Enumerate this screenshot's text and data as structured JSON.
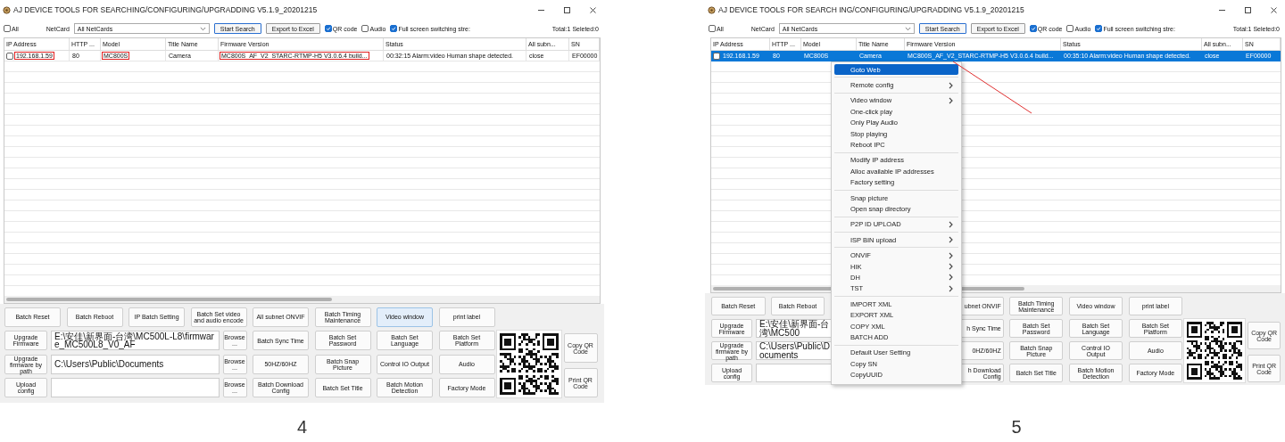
{
  "figures": [
    {
      "window": {
        "title": "AJ DEVICE TOOLS FOR SEARCHING/CONFIGURING/UPGRADDING V5.1.9_20201215"
      },
      "toolbar": {
        "select_all": {
          "label": "All",
          "checked": false
        },
        "netcard_label": "NetCard",
        "netcard": "All NetCards",
        "buttons": [
          {
            "label": "Start Search",
            "focused": true
          },
          {
            "label": "Export to Excel",
            "focused": false
          }
        ],
        "options": [
          {
            "label": "QR code",
            "checked": true
          },
          {
            "label": "Audio",
            "checked": false
          },
          {
            "label": "Full screen switching stre:",
            "checked": true
          }
        ],
        "summary": "Total:1 Seleted:0"
      },
      "table": {
        "columns": [
          "IP Address",
          "HTTP ...",
          "Model",
          "Title Name",
          "Firmware Version",
          "Status",
          "All subn...",
          "SN"
        ],
        "rows": [
          {
            "checked": false,
            "selected": false,
            "cells": [
              {
                "text": "192.168.1.59",
                "outlined": true
              },
              {
                "text": "80",
                "outlined": false
              },
              {
                "text": "MC800S",
                "outlined": true
              },
              {
                "text": "Camera",
                "outlined": false
              },
              {
                "text": "MC800S_AF_V2_STARC-RTMP-H5 V3.0.6.4 build...",
                "outlined": true
              },
              {
                "text": "00:32:15 Alarm:video Human shape detected.",
                "outlined": false
              },
              {
                "text": "close",
                "outlined": false
              },
              {
                "text": "EF00000",
                "outlined": false
              }
            ]
          }
        ]
      },
      "actions": {
        "top_row": [
          {
            "kind": "button",
            "label": "Batch Reset",
            "focused": false
          },
          {
            "kind": "button",
            "label": "Batch Reboot",
            "focused": false
          },
          {
            "kind": "button",
            "label": "IP Batch Setting",
            "focused": false
          },
          {
            "kind": "button",
            "label": "Batch Set video and audio encode",
            "focused": false
          },
          {
            "kind": "button",
            "label": "All subnet ONVIF",
            "focused": false
          },
          {
            "kind": "button",
            "label": "Batch Timing Maintenance",
            "focused": false
          },
          {
            "kind": "button",
            "label": "Video window",
            "focused": true
          },
          {
            "kind": "button",
            "label": "print label",
            "focused": false
          }
        ],
        "rows": [
          {
            "button": {
              "kind": "button",
              "label": "Upgrade Firmware",
              "focused": false
            },
            "path": "E:\\安佳\\新界面-台湾\\MC500L-L8\\firmware_MC500L8_V0_AF",
            "browse": {
              "kind": "button",
              "label": "Browse ...",
              "focused": false
            },
            "buttons": [
              {
                "kind": "button",
                "label": "Batch Sync Time",
                "focused": false
              },
              {
                "kind": "button",
                "label": "Batch Set Password",
                "focused": false
              },
              {
                "kind": "button",
                "label": "Batch Set Language",
                "focused": false
              },
              {
                "kind": "button",
                "label": "Batch Set Platform",
                "focused": false
              }
            ]
          },
          {
            "button": {
              "kind": "button",
              "label": "Upgrade firmware by path",
              "focused": false
            },
            "path": "C:\\Users\\Public\\Documents",
            "browse": {
              "kind": "button",
              "label": "Browse ...",
              "focused": false
            },
            "buttons": [
              {
                "kind": "button",
                "label": "50HZ/60HZ",
                "focused": false
              },
              {
                "kind": "button",
                "label": "Batch Snap Picture",
                "focused": false
              },
              {
                "kind": "button",
                "label": "Control IO Output",
                "focused": false
              },
              {
                "kind": "button",
                "label": "Audio",
                "focused": false
              }
            ]
          },
          {
            "button": {
              "kind": "button",
              "label": "Upload config",
              "focused": false
            },
            "browse": {
              "kind": "button",
              "label": "Browse ...",
              "focused": false
            },
            "buttons": [
              {
                "kind": "button",
                "label": "Batch Download Config",
                "focused": false
              },
              {
                "kind": "button",
                "label": "Batch Set Title",
                "focused": false
              },
              {
                "kind": "button",
                "label": "Batch Motion Detection",
                "focused": false
              },
              {
                "kind": "button",
                "label": "Factory Mode",
                "focused": false
              }
            ]
          }
        ]
      },
      "qr": {
        "buttons": [
          "Copy QR Code",
          "Print QR Code"
        ]
      },
      "caption": "4"
    },
    {
      "window": {
        "title": "AJ DEVICE TOOLS FOR SEARCH ING/CONFIGURING/UPGRADDING V5.1.9_20201215"
      },
      "toolbar": {
        "select_all": {
          "label": "All",
          "checked": false
        },
        "netcard_label": "NetCard",
        "netcard": "All NetCards",
        "buttons": [
          {
            "label": "Start Search",
            "focused": true
          },
          {
            "label": "Export to Excel",
            "focused": false
          }
        ],
        "options": [
          {
            "label": "QR code",
            "checked": true
          },
          {
            "label": "Audio",
            "checked": false
          },
          {
            "label": "Full screen switching stre:",
            "checked": true
          }
        ],
        "summary": "Total:1 Seleted:0"
      },
      "table": {
        "columns": [
          "IP Address",
          "HTTP ...",
          "Model",
          "Title Name",
          "Firmware Version",
          "Status",
          "All subn...",
          "SN"
        ],
        "rows": [
          {
            "checked": false,
            "selected": true,
            "cells": [
              {
                "text": "192.168.1.59",
                "outlined": false
              },
              {
                "text": "80",
                "outlined": false
              },
              {
                "text": "MC800S",
                "outlined": false
              },
              {
                "text": "Camera",
                "outlined": false
              },
              {
                "text": "MC800S_AF_V2_STARC-RTMP-H5 V3.0.6.4 build...",
                "outlined": false
              },
              {
                "text": "00:35:10 Alarm:video Human shape detected.",
                "outlined": false
              },
              {
                "text": "close",
                "outlined": false
              },
              {
                "text": "EF00000",
                "outlined": false
              }
            ]
          }
        ]
      },
      "actions": {
        "top_row": [
          {
            "kind": "button",
            "label": "Batch Reset",
            "focused": false
          },
          {
            "kind": "button",
            "label": "Batch Reboot",
            "focused": false
          },
          {
            "kind": "covered"
          },
          {
            "kind": "covered"
          },
          {
            "kind": "partial",
            "label": "ubnet ONVIF",
            "focused": false
          },
          {
            "kind": "button",
            "label": "Batch Timing Maintenance",
            "focused": false
          },
          {
            "kind": "button",
            "label": "Video window",
            "focused": false
          },
          {
            "kind": "button",
            "label": "print label",
            "focused": false
          }
        ],
        "rows": [
          {
            "button": {
              "kind": "button",
              "label": "Upgrade Firmware",
              "focused": false
            },
            "path": "E:\\安佳\\新界面-台湾\\MC500",
            "browse": {
              "kind": "covered"
            },
            "buttons": [
              {
                "kind": "partial",
                "label": "h Sync Time",
                "focused": false
              },
              {
                "kind": "button",
                "label": "Batch Set Password",
                "focused": false
              },
              {
                "kind": "button",
                "label": "Batch Set Language",
                "focused": false
              },
              {
                "kind": "button",
                "label": "Batch Set Platform",
                "focused": false
              }
            ]
          },
          {
            "button": {
              "kind": "button",
              "label": "Upgrade firmware by path",
              "focused": false
            },
            "path": "C:\\Users\\Public\\Documents",
            "browse": {
              "kind": "covered"
            },
            "buttons": [
              {
                "kind": "partial",
                "label": "0HZ/60HZ",
                "focused": false
              },
              {
                "kind": "button",
                "label": "Batch Snap Picture",
                "focused": false
              },
              {
                "kind": "button",
                "label": "Control IO Output",
                "focused": false
              },
              {
                "kind": "button",
                "label": "Audio",
                "focused": false
              }
            ]
          },
          {
            "button": {
              "kind": "button",
              "label": "Upload config",
              "focused": false
            },
            "browse": {
              "kind": "covered"
            },
            "buttons": [
              {
                "kind": "partial",
                "label": "h Download Config",
                "focused": false
              },
              {
                "kind": "button",
                "label": "Batch Set Title",
                "focused": false
              },
              {
                "kind": "button",
                "label": "Batch Motion Detection",
                "focused": false
              },
              {
                "kind": "button",
                "label": "Factory Mode",
                "focused": false
              }
            ]
          }
        ]
      },
      "qr": {
        "buttons": [
          "Copy QR Code",
          "Print QR Code"
        ]
      },
      "context_menu": {
        "groups": [
          {
            "items": [
              {
                "label": "Goto Web",
                "selected": true
              }
            ]
          },
          {
            "items": [
              {
                "label": "Remote config",
                "submenu": true,
                "selected": false
              }
            ]
          },
          {
            "items": [
              {
                "label": "Video window",
                "submenu": true,
                "selected": false
              },
              {
                "label": "One-click play",
                "selected": false
              },
              {
                "label": "Only Play Audio",
                "selected": false
              },
              {
                "label": "Stop playing",
                "selected": false
              },
              {
                "label": "Reboot IPC",
                "selected": false
              }
            ]
          },
          {
            "items": [
              {
                "label": "Modify IP address",
                "selected": false
              },
              {
                "label": "Alloc available IP addresses",
                "selected": false
              },
              {
                "label": "Factory setting",
                "selected": false
              }
            ]
          },
          {
            "items": [
              {
                "label": "Snap picture",
                "selected": false
              },
              {
                "label": "Open snap directory",
                "selected": false
              }
            ]
          },
          {
            "items": [
              {
                "label": "P2P ID UPLOAD",
                "submenu": true,
                "selected": false
              }
            ]
          },
          {
            "items": [
              {
                "label": "ISP BIN upload",
                "submenu": true,
                "selected": false
              }
            ]
          },
          {
            "items": [
              {
                "label": "ONVIF",
                "submenu": true,
                "selected": false
              },
              {
                "label": "HIK",
                "submenu": true,
                "selected": false
              },
              {
                "label": "DH",
                "submenu": true,
                "selected": false
              },
              {
                "label": "TST",
                "submenu": true,
                "selected": false
              }
            ]
          },
          {
            "items": [
              {
                "label": "IMPORT XML",
                "selected": false
              },
              {
                "label": "EXPORT XML",
                "selected": false
              },
              {
                "label": "COPY XML",
                "selected": false
              },
              {
                "label": "BATCH ADD",
                "selected": false
              }
            ]
          },
          {
            "items": [
              {
                "label": "Default User Setting",
                "selected": false
              },
              {
                "label": "Copy SN",
                "selected": false
              },
              {
                "label": "CopyUUID",
                "selected": false
              }
            ]
          }
        ]
      },
      "caption": "5"
    }
  ]
}
